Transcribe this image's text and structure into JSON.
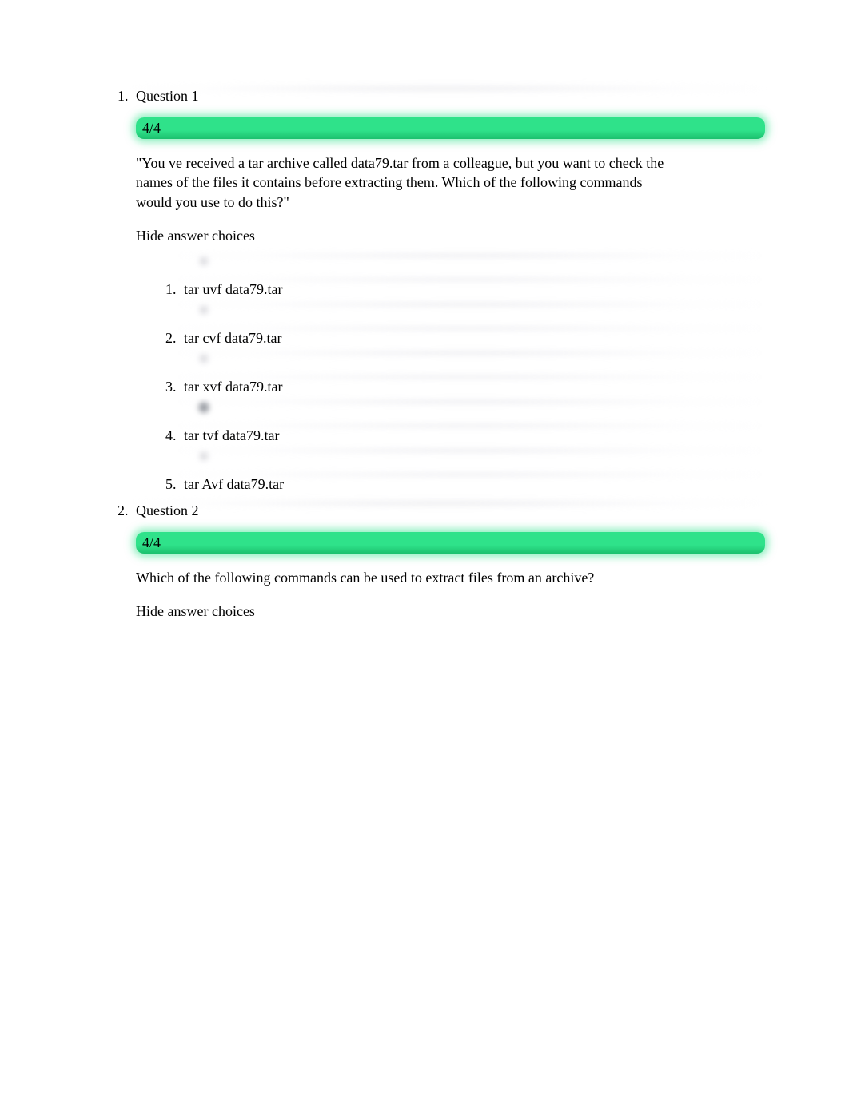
{
  "questions": [
    {
      "title": "Question 1",
      "score": "4/4",
      "prompt": "\"You ve received a tar archive called data79.tar from a colleague, but you want to check the names of the files it contains before extracting them. Which of the following commands would you use to do this?\"",
      "hide_label": "Hide answer choices",
      "choices": [
        {
          "text": "tar uvf data79.tar",
          "selected": false
        },
        {
          "text": "tar cvf data79.tar",
          "selected": false
        },
        {
          "text": "tar xvf data79.tar",
          "selected": false
        },
        {
          "text": "tar tvf data79.tar",
          "selected": true
        },
        {
          "text": "tar Avf data79.tar",
          "selected": false
        }
      ]
    },
    {
      "title": "Question 2",
      "score": "4/4",
      "prompt": "Which of the following commands can be used to extract files from an archive?",
      "hide_label": "Hide answer choices"
    }
  ]
}
